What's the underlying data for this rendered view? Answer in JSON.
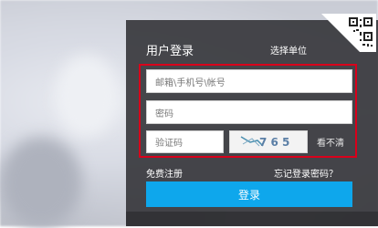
{
  "login": {
    "title": "用户登录",
    "select_unit": "选择单位",
    "account_placeholder": "邮箱\\手机号\\帐号",
    "password_placeholder": "密码",
    "captcha_placeholder": "验证码",
    "captcha_text": "7 6 5",
    "refresh_captcha": "看不清",
    "register": "免费注册",
    "forgot_password": "忘记登录密码？",
    "submit": "登录"
  },
  "colors": {
    "panel": "#343438",
    "accent": "#0ea7ec",
    "highlight_frame": "#d9001b"
  }
}
